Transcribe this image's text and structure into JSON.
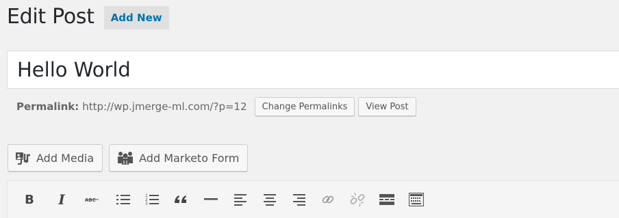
{
  "header": {
    "title": "Edit Post",
    "add_new_label": "Add New"
  },
  "post": {
    "title": "Hello World",
    "permalink_label": "Permalink:",
    "permalink_url": "http://wp.jmerge-ml.com/?p=12",
    "change_permalinks_label": "Change Permalinks",
    "view_post_label": "View Post"
  },
  "media_buttons": {
    "add_media_label": "Add Media",
    "add_marketo_form_label": "Add Marketo Form"
  },
  "toolbar": {
    "bold_label": "B",
    "italic_label": "I",
    "buttons": [
      "bold-icon",
      "italic-icon",
      "strikethrough-icon",
      "bulleted-list-icon",
      "numbered-list-icon",
      "blockquote-icon",
      "horizontal-line-icon",
      "align-left-icon",
      "align-center-icon",
      "align-right-icon",
      "insert-link-icon",
      "remove-link-icon",
      "read-more-icon",
      "toolbar-toggle-icon"
    ]
  }
}
